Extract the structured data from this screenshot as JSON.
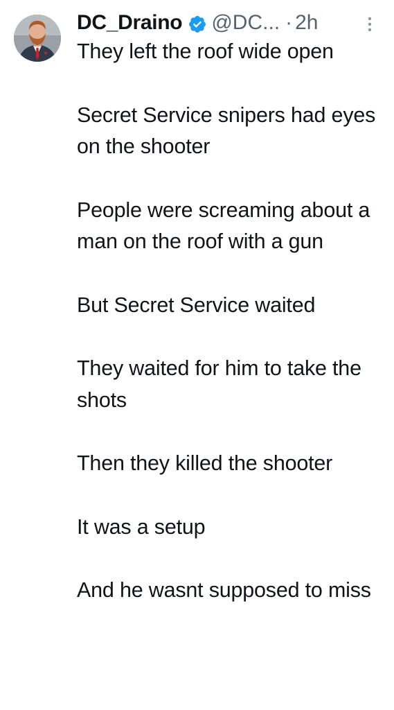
{
  "tweet": {
    "display_name": "DC_Draino",
    "handle": "@DC...",
    "separator": "·",
    "time": "2h",
    "avatar_icon": "profile-photo",
    "verified_icon": "verified-badge-icon",
    "verified_color": "#1d9bf0",
    "more_icon": "more-options-icon",
    "paragraphs": [
      "They left the roof wide open",
      "Secret Service snipers had eyes on the shooter",
      "People were screaming about a man on the roof with a gun",
      "But Secret Service waited",
      "They waited for him to take the shots",
      "Then they killed the shooter",
      "It was a setup",
      "And he wasnt supposed to miss"
    ]
  }
}
